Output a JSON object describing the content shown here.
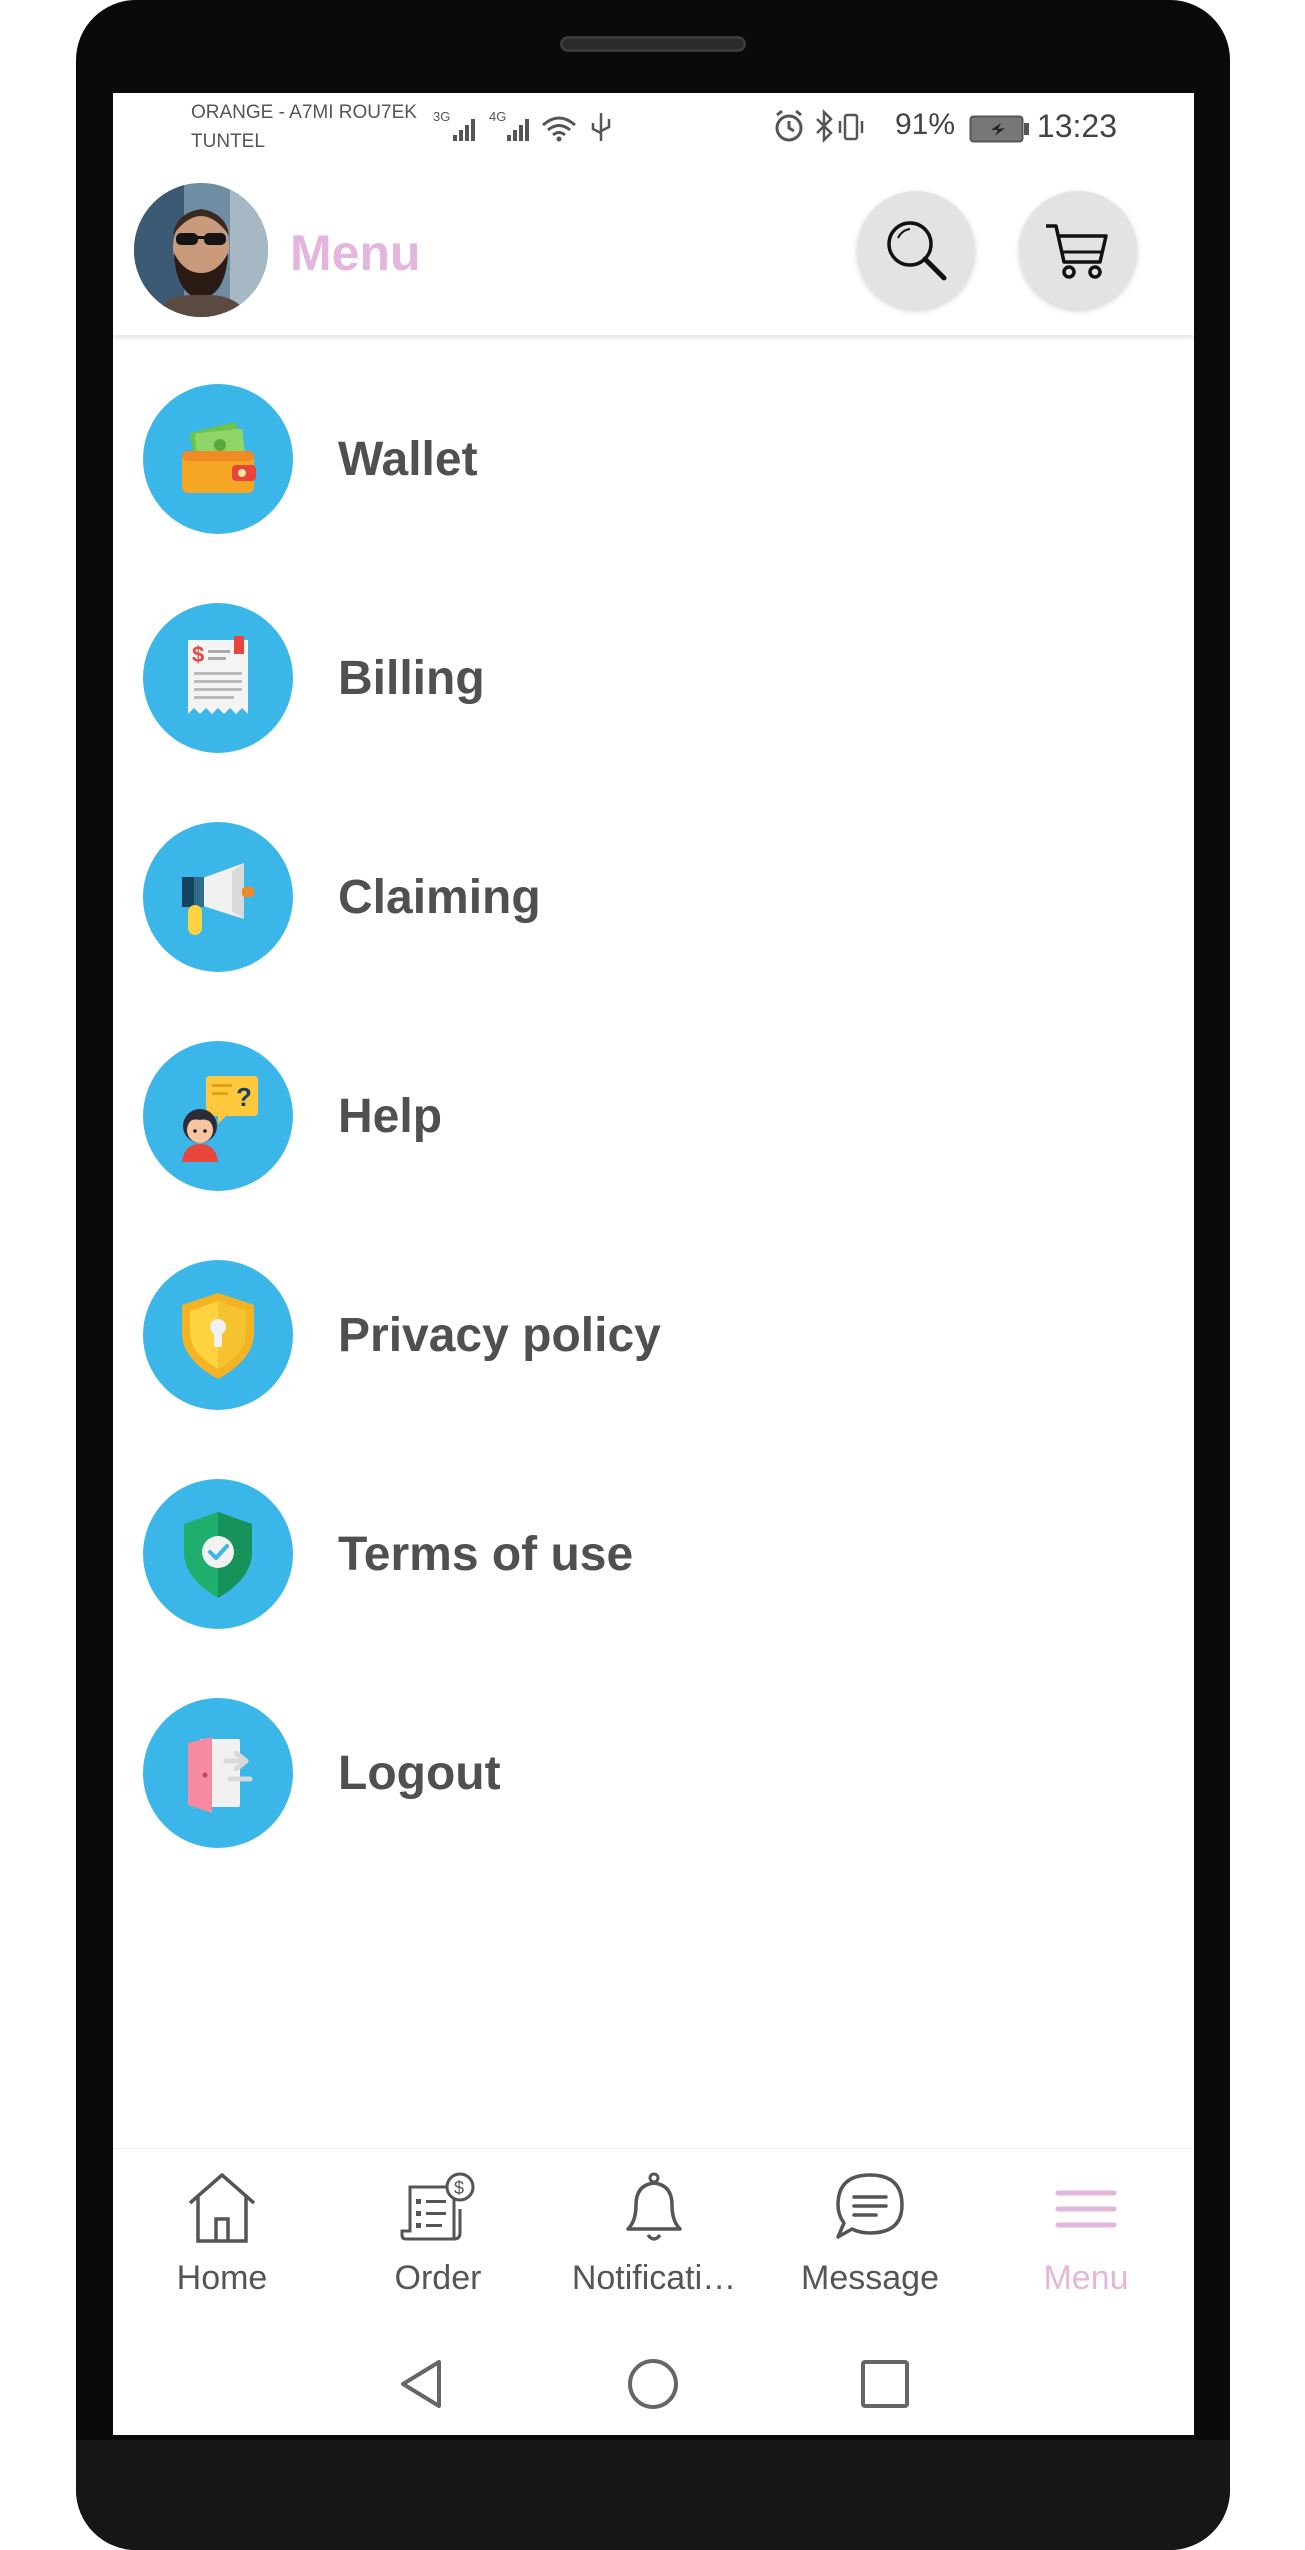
{
  "status_bar": {
    "carrier_line1": "ORANGE - A7MI ROU7EK",
    "carrier_line2": "TUNTEL",
    "network1": "3G",
    "network2": "4G",
    "battery_percent": "91%",
    "time": "13:23"
  },
  "header": {
    "title": "Menu",
    "search_icon": "search-icon",
    "cart_icon": "cart-icon"
  },
  "menu": {
    "items": [
      {
        "label": "Wallet",
        "icon": "wallet-icon"
      },
      {
        "label": "Billing",
        "icon": "receipt-icon"
      },
      {
        "label": "Claiming",
        "icon": "megaphone-icon"
      },
      {
        "label": "Help",
        "icon": "help-chat-icon"
      },
      {
        "label": "Privacy policy",
        "icon": "shield-keyhole-icon"
      },
      {
        "label": "Terms of use",
        "icon": "shield-check-icon"
      },
      {
        "label": "Logout",
        "icon": "door-exit-icon"
      }
    ]
  },
  "bottom_nav": {
    "items": [
      {
        "label": "Home",
        "icon": "home-icon"
      },
      {
        "label": "Order",
        "icon": "order-list-icon"
      },
      {
        "label": "Notificati…",
        "icon": "bell-icon"
      },
      {
        "label": "Message",
        "icon": "message-icon"
      },
      {
        "label": "Menu",
        "icon": "hamburger-icon",
        "active": true
      }
    ]
  },
  "colors": {
    "accent": "#e4b6de",
    "menu_circle": "#3bb6e8",
    "text": "#505050"
  }
}
